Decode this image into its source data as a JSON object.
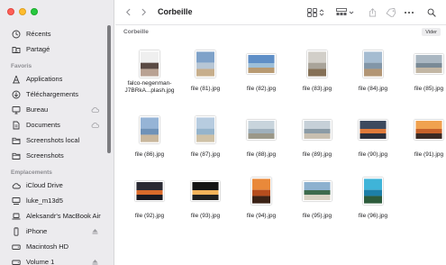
{
  "window": {
    "title": "Corbeille"
  },
  "sidebar": {
    "top_items": [
      {
        "label": "Récents",
        "icon": "clock-icon"
      },
      {
        "label": "Partagé",
        "icon": "shared-folder-icon"
      }
    ],
    "favorites_header": "Favoris",
    "favorites": [
      {
        "label": "Applications",
        "icon": "applications-icon",
        "cloud": false
      },
      {
        "label": "Téléchargements",
        "icon": "download-icon",
        "cloud": false
      },
      {
        "label": "Bureau",
        "icon": "desktop-icon",
        "cloud": true
      },
      {
        "label": "Documents",
        "icon": "document-icon",
        "cloud": true
      },
      {
        "label": "Screenshots local",
        "icon": "folder-icon",
        "cloud": false
      },
      {
        "label": "Screenshots",
        "icon": "folder-icon",
        "cloud": false
      }
    ],
    "locations_header": "Emplacements",
    "locations": [
      {
        "label": "iCloud Drive",
        "icon": "icloud-icon",
        "eject": false
      },
      {
        "label": "luke_m13d5",
        "icon": "network-computer-icon",
        "eject": false
      },
      {
        "label": "Aleksandr's MacBook Air",
        "icon": "laptop-icon",
        "eject": false
      },
      {
        "label": "iPhone",
        "icon": "iphone-icon",
        "eject": true
      },
      {
        "label": "Macintosh HD",
        "icon": "hard-drive-icon",
        "eject": false
      },
      {
        "label": "Volume 1",
        "icon": "hard-drive-icon",
        "eject": true
      }
    ]
  },
  "toolbar": {
    "back_icon": "chevron-left-icon",
    "forward_icon": "chevron-right-icon",
    "view_icon": "grid-view-icon",
    "group_icon": "group-by-icon",
    "share_icon": "share-icon",
    "tag_icon": "tag-icon",
    "more_icon": "ellipsis-icon",
    "search_icon": "search-icon"
  },
  "pathbar": {
    "label": "Corbeille",
    "empty_button": "Vider"
  },
  "files": [
    {
      "name": "falco-negenman-J7BRkA...plash.jpg",
      "orientation": "portrait",
      "colors": [
        "#efefef",
        "#5a4a44",
        "#b9a293"
      ]
    },
    {
      "name": "file (81).jpg",
      "orientation": "portrait",
      "colors": [
        "#7fa2c9",
        "#b7c6d5",
        "#c7ae8b"
      ]
    },
    {
      "name": "file (82).jpg",
      "orientation": "landscape",
      "colors": [
        "#5f8fc7",
        "#9dbfd9",
        "#b89a72"
      ]
    },
    {
      "name": "file (83).jpg",
      "orientation": "portrait",
      "colors": [
        "#d2cfc9",
        "#a9a49a",
        "#857056"
      ]
    },
    {
      "name": "file (84).jpg",
      "orientation": "portrait",
      "colors": [
        "#a5bcd1",
        "#8296a8",
        "#b29574"
      ]
    },
    {
      "name": "file (85).jpg",
      "orientation": "landscape",
      "colors": [
        "#aab7c2",
        "#7a8a96",
        "#c2b6a4"
      ]
    },
    {
      "name": "file (86).jpg",
      "orientation": "portrait",
      "colors": [
        "#96b4d6",
        "#6f92b8",
        "#c9b79d"
      ]
    },
    {
      "name": "file (87).jpg",
      "orientation": "portrait",
      "colors": [
        "#b7cce0",
        "#95b4cc",
        "#cfc1a6"
      ]
    },
    {
      "name": "file (88).jpg",
      "orientation": "landscape",
      "colors": [
        "#c8d4dc",
        "#9fb0bc",
        "#9b9889"
      ]
    },
    {
      "name": "file (89).jpg",
      "orientation": "landscape",
      "colors": [
        "#c6d0d8",
        "#8b9ba6",
        "#c8bfb0"
      ]
    },
    {
      "name": "file (90).jpg",
      "orientation": "landscape",
      "colors": [
        "#3d4a5e",
        "#e07a3a",
        "#2b2f3b"
      ]
    },
    {
      "name": "file (91).jpg",
      "orientation": "landscape",
      "colors": [
        "#f0a24f",
        "#c7622a",
        "#3a2a24"
      ]
    },
    {
      "name": "file (92).jpg",
      "orientation": "landscape",
      "colors": [
        "#2a2a33",
        "#d96a2b",
        "#1a1a22"
      ]
    },
    {
      "name": "file (93).jpg",
      "orientation": "landscape",
      "colors": [
        "#151515",
        "#f3b35a",
        "#202020"
      ]
    },
    {
      "name": "file (94).jpg",
      "orientation": "portrait",
      "colors": [
        "#e9893a",
        "#b64d1e",
        "#3b2216"
      ]
    },
    {
      "name": "file (95).jpg",
      "orientation": "landscape",
      "colors": [
        "#8db1cf",
        "#3e6b4d",
        "#d8d2c2"
      ]
    },
    {
      "name": "file (96).jpg",
      "orientation": "portrait",
      "colors": [
        "#3fb4d8",
        "#1d7fa8",
        "#2d5c3c"
      ]
    }
  ]
}
